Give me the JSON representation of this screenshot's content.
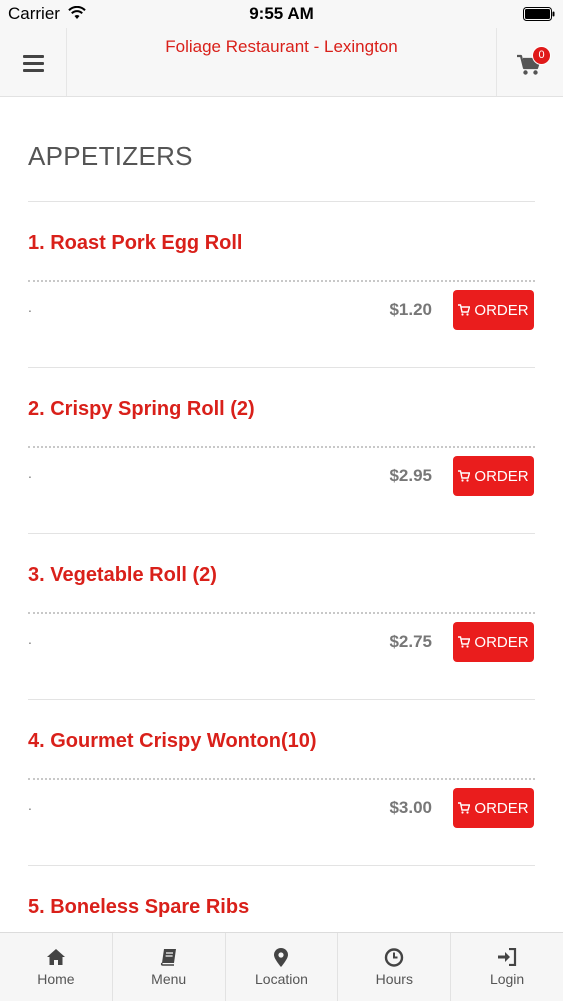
{
  "status_bar": {
    "carrier": "Carrier",
    "time": "9:55 AM"
  },
  "header": {
    "title": "Foliage Restaurant - Lexington",
    "cart_count": "0"
  },
  "section": {
    "title": "APPETIZERS"
  },
  "items": [
    {
      "name": "1. Roast Pork Egg Roll",
      "description": ".",
      "price": "$1.20",
      "order_label": "ORDER"
    },
    {
      "name": "2. Crispy Spring Roll (2)",
      "description": ".",
      "price": "$2.95",
      "order_label": "ORDER"
    },
    {
      "name": "3. Vegetable Roll (2)",
      "description": ".",
      "price": "$2.75",
      "order_label": "ORDER"
    },
    {
      "name": "4. Gourmet Crispy Wonton(10)",
      "description": ".",
      "price": "$3.00",
      "order_label": "ORDER"
    },
    {
      "name": "5. Boneless Spare Ribs"
    }
  ],
  "nav": [
    {
      "label": "Home",
      "icon": "home-icon"
    },
    {
      "label": "Menu",
      "icon": "book-icon"
    },
    {
      "label": "Location",
      "icon": "map-marker-icon"
    },
    {
      "label": "Hours",
      "icon": "clock-icon"
    },
    {
      "label": "Login",
      "icon": "login-icon"
    }
  ],
  "colors": {
    "accent": "#d9201a",
    "button": "#ea1d1d",
    "price": "#777777"
  }
}
